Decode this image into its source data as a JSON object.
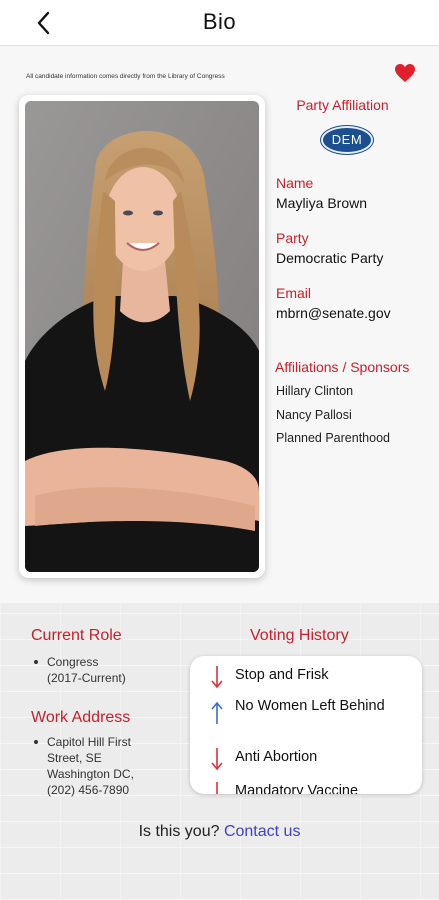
{
  "header": {
    "title": "Bio",
    "back_icon": "chevron-left-icon"
  },
  "disclaimer": "All candidate information comes directly from the Library of Congress",
  "favorite": {
    "icon": "heart-icon",
    "color": "#e0202c"
  },
  "party_affiliation": {
    "title": "Party Affiliation",
    "badge": "DEM",
    "badge_color": "#1c4f8f"
  },
  "profile": {
    "name_label": "Name",
    "name": "Mayliya Brown",
    "party_label": "Party",
    "party": "Democratic Party",
    "email_label": "Email",
    "email": "mbrn@senate.gov"
  },
  "affiliations": {
    "title": "Affiliations / Sponsors",
    "items": [
      "Hillary Clinton",
      "Nancy Pallosi",
      "Planned Parenthood"
    ]
  },
  "current_role": {
    "title": "Current Role",
    "lines": [
      "Congress",
      "(2017-Current)"
    ]
  },
  "work_address": {
    "title": "Work Address",
    "lines": [
      "Capitol Hill First",
      "Street, SE",
      "Washington DC,",
      "(202) 456-7890"
    ]
  },
  "voting_history": {
    "title": "Voting History",
    "items": [
      {
        "label": "Stop and Frisk",
        "direction": "down",
        "color": "#e0303a"
      },
      {
        "label": "No Women Left Behind",
        "direction": "up",
        "color": "#3a6fc9"
      },
      {
        "label": "Anti Abortion",
        "direction": "down",
        "color": "#e0303a"
      },
      {
        "label": "Mandatory Vaccine",
        "direction": "down",
        "color": "#e0303a"
      }
    ]
  },
  "footer": {
    "prompt": "Is this you?",
    "link": "Contact us",
    "link_color": "#3d3fcf"
  },
  "accent_color": "#c8202c"
}
